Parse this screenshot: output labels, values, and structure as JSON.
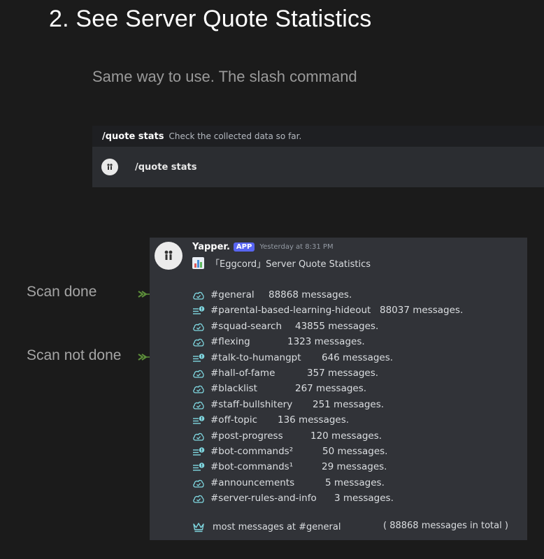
{
  "heading": "2. See Server Quote Statistics",
  "intro": "Same way to use. The slash command",
  "command_box": {
    "name": "/quote stats",
    "description": "Check the collected data so far.",
    "option_label": "/quote stats"
  },
  "message": {
    "username": "Yapper.",
    "badge": "APP",
    "timestamp": "Yesterday at 8:31 PM",
    "title": "「Eggcord」Server Quote Statistics",
    "channels": [
      {
        "name": "#general",
        "count": "88868 messages.",
        "status": "done"
      },
      {
        "name": "#parental-based-learning-hideout",
        "count": "88037 messages.",
        "status": "not-done"
      },
      {
        "name": "#squad-search",
        "count": "43855 messages.",
        "status": "done"
      },
      {
        "name": "#flexing",
        "count": "1323 messages.",
        "status": "done"
      },
      {
        "name": "#talk-to-humangpt",
        "count": "646 messages.",
        "status": "not-done"
      },
      {
        "name": "#hall-of-fame",
        "count": "357 messages.",
        "status": "done"
      },
      {
        "name": "#blacklist",
        "count": "267 messages.",
        "status": "done"
      },
      {
        "name": "#staff-bullshitery",
        "count": "251 messages.",
        "status": "done"
      },
      {
        "name": "#off-topic",
        "count": "136 messages.",
        "status": "not-done"
      },
      {
        "name": "#post-progress",
        "count": "120 messages.",
        "status": "done"
      },
      {
        "name": "#bot-commands²",
        "count": "50 messages.",
        "status": "not-done"
      },
      {
        "name": "#bot-commands¹",
        "count": "29 messages.",
        "status": "not-done"
      },
      {
        "name": "#announcements",
        "count": "5 messages.",
        "status": "done"
      },
      {
        "name": "#server-rules-and-info",
        "count": "3 messages.",
        "status": "done"
      }
    ],
    "footer_left": "most messages at #general",
    "footer_right": "( 88868 messages in total )"
  },
  "annotations": {
    "scan_done": "Scan done",
    "scan_not_done": "Scan not done"
  },
  "colors": {
    "page_bg": "#1b1b1b",
    "discord_bg": "#313338",
    "app_badge": "#5865f2",
    "icon_teal": "#7fd7e0",
    "arrow_green": "#5d8f3a"
  },
  "icons": {
    "done": "cloud-check-icon",
    "not_done": "list-alert-icon",
    "crown": "crown-icon"
  }
}
